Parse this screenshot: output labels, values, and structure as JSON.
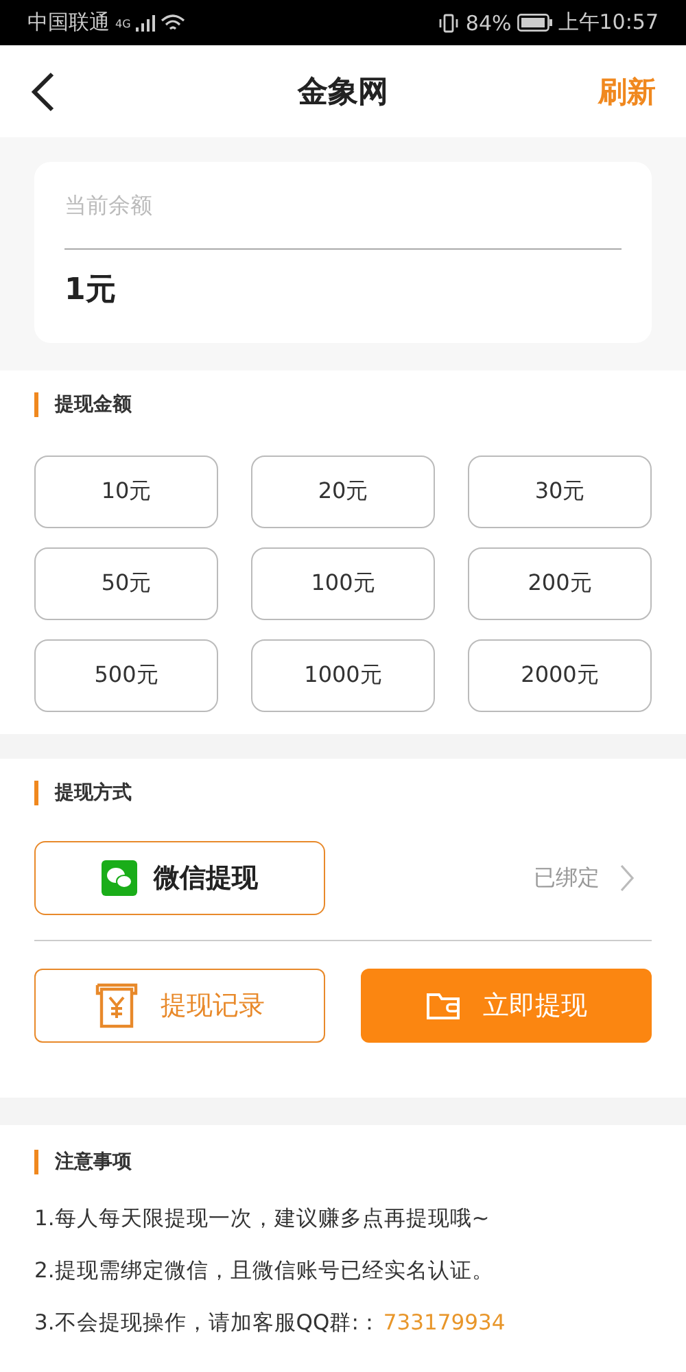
{
  "status_bar": {
    "carrier": "中国联通",
    "network": "4G",
    "battery": "84%",
    "time": "上午10:57"
  },
  "header": {
    "title": "金象网",
    "action": "刷新"
  },
  "balance": {
    "label": "当前余额",
    "value": "1元"
  },
  "amount_section": {
    "title": "提现金额",
    "amounts": [
      "10元",
      "20元",
      "30元",
      "50元",
      "100元",
      "200元",
      "500元",
      "1000元",
      "2000元"
    ]
  },
  "method_section": {
    "title": "提现方式",
    "method": "微信提现",
    "bind_status": "已绑定",
    "record_button": "提现记录",
    "submit_button": "立即提现"
  },
  "notes": {
    "title": "注意事项",
    "items": [
      {
        "text": "1.每人每天限提现一次，建议赚多点再提现哦~"
      },
      {
        "text": "2.提现需绑定微信，且微信账号已经实名认证。"
      },
      {
        "text": "3.不会提现操作，请加客服QQ群:：",
        "highlight": "733179934"
      }
    ]
  }
}
